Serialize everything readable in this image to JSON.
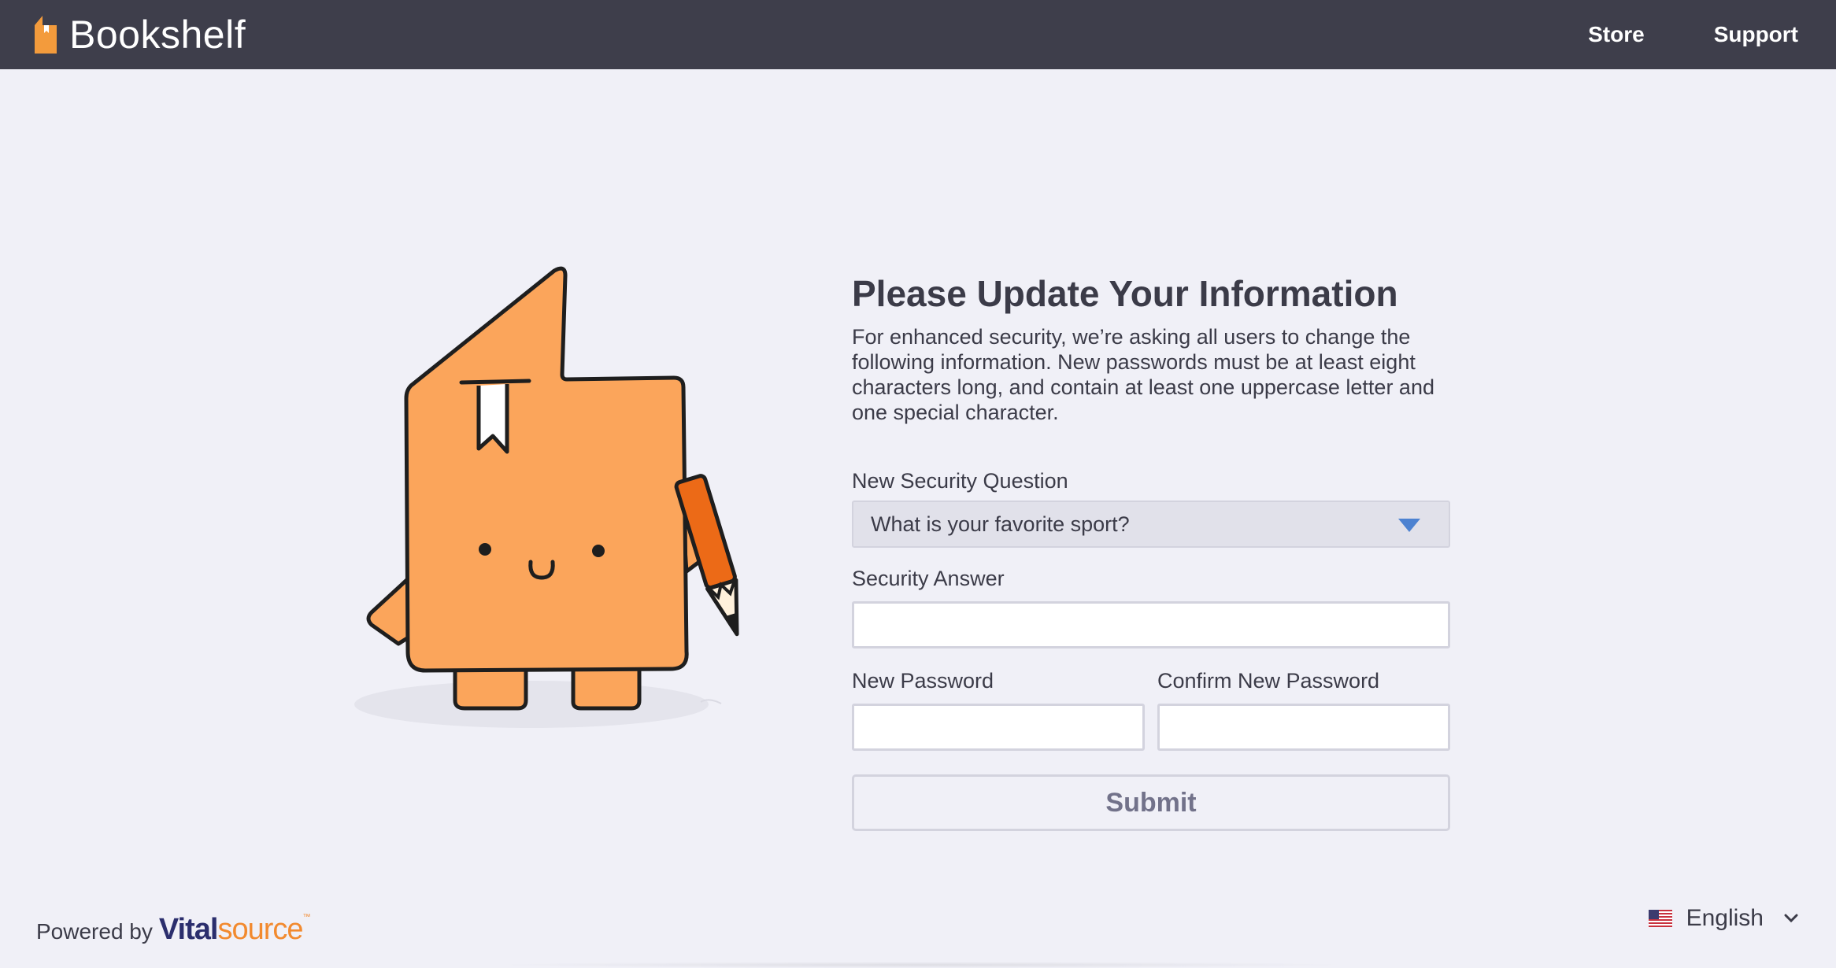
{
  "header": {
    "app_name": "Bookshelf",
    "logo_icon": "bookshelf-logo-icon",
    "nav": [
      {
        "label": "Store"
      },
      {
        "label": "Support"
      }
    ]
  },
  "form": {
    "title": "Please Update Your Information",
    "intro": "For enhanced security, we’re asking all users to change the following information. New passwords must be at least eight characters long, and contain at least one uppercase letter and one special character.",
    "security_question": {
      "label": "New Security Question",
      "selected": "What is your favorite sport?"
    },
    "security_answer": {
      "label": "Security Answer",
      "value": ""
    },
    "new_password": {
      "label": "New Password",
      "value": ""
    },
    "confirm_password": {
      "label": "Confirm New Password",
      "value": ""
    },
    "submit_label": "Submit"
  },
  "footer": {
    "powered_by": "Powered by",
    "vendor_part1": "Vital",
    "vendor_part2": "source",
    "vendor_tm": "™",
    "language": "English",
    "language_icon": "us-flag-icon"
  },
  "colors": {
    "header_bg": "#3e3e4b",
    "page_bg": "#f0f0f7",
    "mascot_orange": "#fba55b",
    "pencil_orange": "#ec6a17",
    "select_arrow_blue": "#4d82d1",
    "vendor_navy": "#2b2e6d",
    "vendor_orange": "#f28a2f"
  }
}
